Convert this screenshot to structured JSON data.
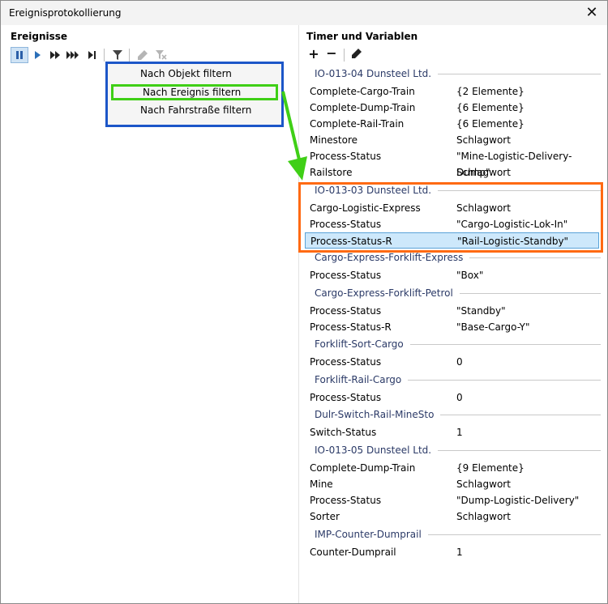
{
  "window": {
    "title": "Ereignisprotokollierung"
  },
  "left_pane": {
    "title": "Ereignisse"
  },
  "menu": {
    "items": [
      "Nach Objekt filtern",
      "Nach Ereignis filtern",
      "Nach Fahrstraße filtern"
    ],
    "highlighted": 1
  },
  "right_pane": {
    "title": "Timer und Variablen"
  },
  "groups": [
    {
      "header": "IO-013-04 Dunsteel Ltd.",
      "rows": [
        [
          "Complete-Cargo-Train",
          "{2 Elemente}"
        ],
        [
          "Complete-Dump-Train",
          "{6 Elemente}"
        ],
        [
          "Complete-Rail-Train",
          "{6 Elemente}"
        ],
        [
          "Minestore",
          "Schlagwort"
        ],
        [
          "Process-Status",
          "\"Mine-Logistic-Delivery-Dump\""
        ],
        [
          "Railstore",
          "Schlagwort"
        ]
      ]
    },
    {
      "header": "IO-013-03 Dunsteel Ltd.",
      "rows": [
        [
          "Cargo-Logistic-Express",
          "Schlagwort"
        ],
        [
          "Process-Status",
          "\"Cargo-Logistic-Lok-In\""
        ],
        [
          "Process-Status-R",
          "\"Rail-Logistic-Standby\""
        ]
      ]
    },
    {
      "header": "Cargo-Express-Forklift-Express",
      "rows": [
        [
          "Process-Status",
          "\"Box\""
        ]
      ]
    },
    {
      "header": "Cargo-Express-Forklift-Petrol",
      "rows": [
        [
          "Process-Status",
          "\"Standby\""
        ],
        [
          "Process-Status-R",
          "\"Base-Cargo-Y\""
        ]
      ]
    },
    {
      "header": "Forklift-Sort-Cargo",
      "rows": [
        [
          "Process-Status",
          "0"
        ]
      ]
    },
    {
      "header": "Forklift-Rail-Cargo",
      "rows": [
        [
          "Process-Status",
          "0"
        ]
      ]
    },
    {
      "header": "Dulr-Switch-Rail-MineSto",
      "rows": [
        [
          "Switch-Status",
          "1"
        ]
      ]
    },
    {
      "header": "IO-013-05 Dunsteel Ltd.",
      "rows": [
        [
          "Complete-Dump-Train",
          "{9 Elemente}"
        ],
        [
          "Mine",
          "Schlagwort"
        ],
        [
          "Process-Status",
          "\"Dump-Logistic-Delivery\""
        ],
        [
          "Sorter",
          "Schlagwort"
        ]
      ]
    },
    {
      "header": "IMP-Counter-Dumprail",
      "rows": [
        [
          "Counter-Dumprail",
          "1"
        ]
      ]
    }
  ],
  "colors": {
    "menu_border": "#1c56c8",
    "highlight_green": "#3fcf16",
    "focus_orange": "#ff6a13",
    "selected_row": "#cde8fb"
  },
  "icons": [
    "pause-icon",
    "play-icon",
    "fast-forward-icon",
    "faster-forward-icon",
    "skip-to-end-icon",
    "filter-icon",
    "edit-icon",
    "clear-filter-icon",
    "add-icon",
    "remove-icon",
    "edit-variable-icon",
    "close-icon"
  ]
}
